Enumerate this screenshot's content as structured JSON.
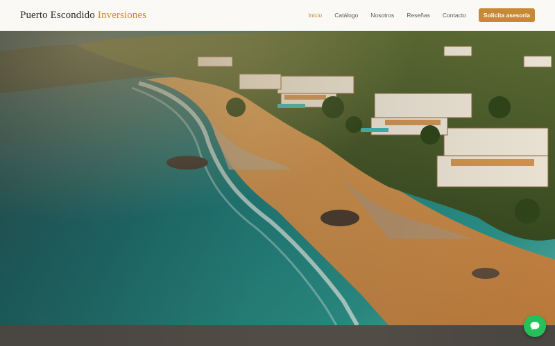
{
  "brand": {
    "name_main": "Puerto Escondido",
    "name_accent": "Inversiones"
  },
  "nav": {
    "items": [
      {
        "label": "Inicio",
        "active": true
      },
      {
        "label": "Catálogo",
        "active": false
      },
      {
        "label": "Nosotros",
        "active": false
      },
      {
        "label": "Reseñas",
        "active": false
      },
      {
        "label": "Contacto",
        "active": false
      }
    ],
    "cta_label": "Solicita asesoría"
  },
  "colors": {
    "accent": "#c68a37",
    "chat": "#24c15a",
    "header_bg": "#faf9f6"
  },
  "hero": {
    "image": "coastal-villas-beach-photo"
  },
  "chat_widget": {
    "icon": "chat-bubble-icon"
  }
}
